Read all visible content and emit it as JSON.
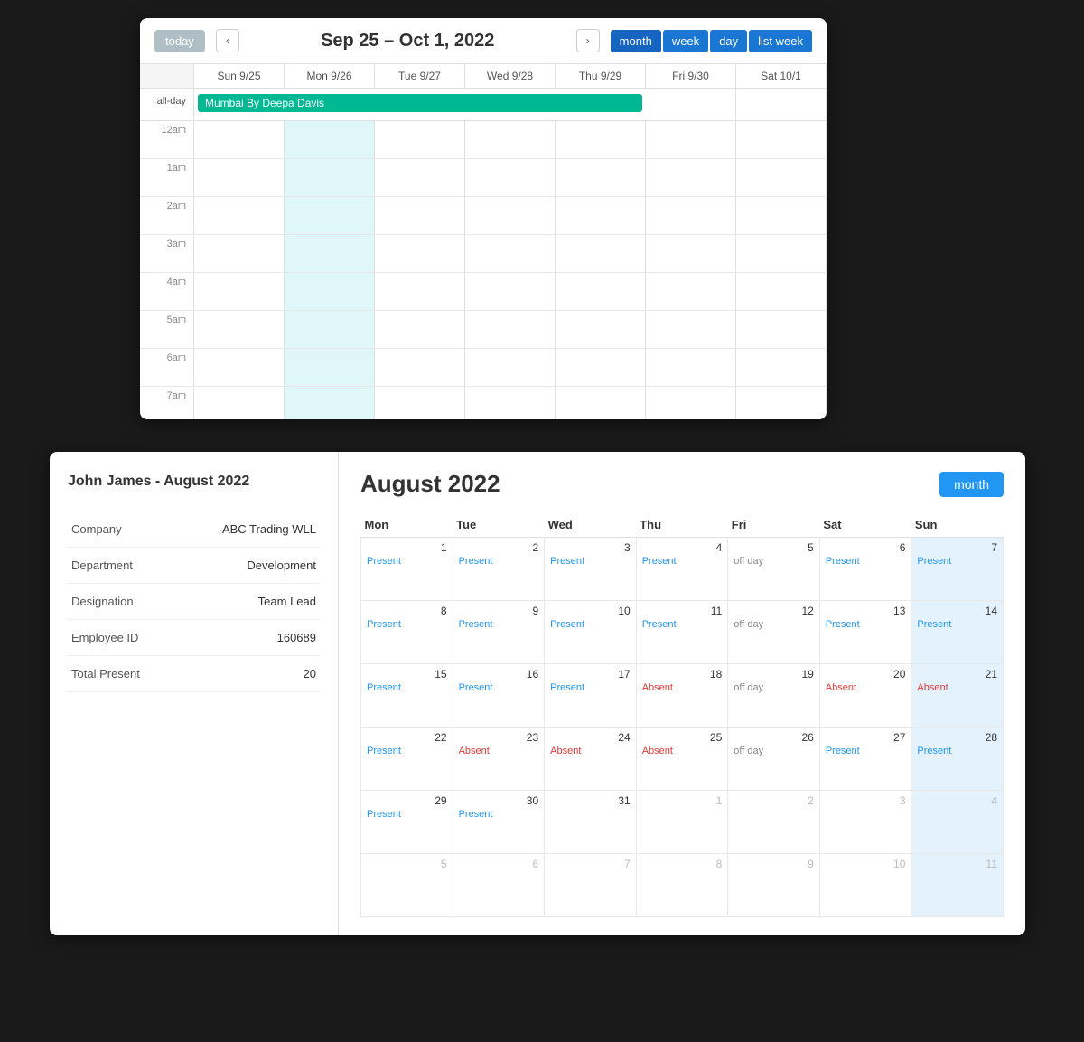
{
  "topCalendar": {
    "todayBtn": "today",
    "prevBtn": "‹",
    "nextBtn": "›",
    "dateRange": "Sep 25 – Oct 1, 2022",
    "viewButtons": [
      {
        "label": "month",
        "active": true
      },
      {
        "label": "week",
        "active": false
      },
      {
        "label": "day",
        "active": false
      },
      {
        "label": "list week",
        "active": false
      }
    ],
    "headerCells": [
      "",
      "Sun 9/25",
      "Mon 9/26",
      "Tue 9/27",
      "Wed 9/28",
      "Thu 9/29",
      "Fri 9/30",
      "Sat 10/1"
    ],
    "allDayLabel": "all-day",
    "event": "Mumbai By Deepa Davis",
    "timeSlots": [
      "12am",
      "1am",
      "2am",
      "3am",
      "4am",
      "5am",
      "6am",
      "7am"
    ]
  },
  "bottomCalendar": {
    "sidebar": {
      "title": "John James - August 2022",
      "fields": [
        {
          "label": "Company",
          "value": "ABC Trading WLL"
        },
        {
          "label": "Department",
          "value": "Development"
        },
        {
          "label": "Designation",
          "value": "Team Lead"
        },
        {
          "label": "Employee ID",
          "value": "160689"
        },
        {
          "label": "Total Present",
          "value": "20"
        }
      ]
    },
    "monthTitle": "August 2022",
    "monthBtn": "month",
    "weekHeaders": [
      "Mon",
      "Tue",
      "Wed",
      "Thu",
      "Fri",
      "Sat",
      "Sun"
    ],
    "weeks": [
      [
        {
          "date": "1",
          "status": "Present",
          "type": "present"
        },
        {
          "date": "2",
          "status": "Present",
          "type": "present"
        },
        {
          "date": "3",
          "status": "Present",
          "type": "present"
        },
        {
          "date": "4",
          "status": "Present",
          "type": "present"
        },
        {
          "date": "5",
          "status": "off day",
          "type": "offday"
        },
        {
          "date": "6",
          "status": "Present",
          "type": "present"
        },
        {
          "date": "7",
          "status": "Present",
          "type": "present",
          "highlight": true
        }
      ],
      [
        {
          "date": "8",
          "status": "Present",
          "type": "present"
        },
        {
          "date": "9",
          "status": "Present",
          "type": "present"
        },
        {
          "date": "10",
          "status": "Present",
          "type": "present"
        },
        {
          "date": "11",
          "status": "Present",
          "type": "present"
        },
        {
          "date": "12",
          "status": "off day",
          "type": "offday"
        },
        {
          "date": "13",
          "status": "Present",
          "type": "present"
        },
        {
          "date": "14",
          "status": "Present",
          "type": "present",
          "highlight": true
        }
      ],
      [
        {
          "date": "15",
          "status": "Present",
          "type": "present"
        },
        {
          "date": "16",
          "status": "Present",
          "type": "present"
        },
        {
          "date": "17",
          "status": "Present",
          "type": "present"
        },
        {
          "date": "18",
          "status": "Absent",
          "type": "absent"
        },
        {
          "date": "19",
          "status": "off day",
          "type": "offday"
        },
        {
          "date": "20",
          "status": "Absent",
          "type": "absent"
        },
        {
          "date": "21",
          "status": "Absent",
          "type": "absent",
          "highlight": true
        }
      ],
      [
        {
          "date": "22",
          "status": "Present",
          "type": "present"
        },
        {
          "date": "23",
          "status": "Absent",
          "type": "absent"
        },
        {
          "date": "24",
          "status": "Absent",
          "type": "absent"
        },
        {
          "date": "25",
          "status": "Absent",
          "type": "absent"
        },
        {
          "date": "26",
          "status": "off day",
          "type": "offday"
        },
        {
          "date": "27",
          "status": "Present",
          "type": "present"
        },
        {
          "date": "28",
          "status": "Present",
          "type": "present",
          "highlight": true
        }
      ],
      [
        {
          "date": "29",
          "status": "Present",
          "type": "present"
        },
        {
          "date": "30",
          "status": "Present",
          "type": "present"
        },
        {
          "date": "31",
          "status": "",
          "type": "empty"
        },
        {
          "date": "1",
          "status": "",
          "type": "other",
          "otherMonth": true
        },
        {
          "date": "2",
          "status": "",
          "type": "other",
          "otherMonth": true
        },
        {
          "date": "3",
          "status": "",
          "type": "other",
          "otherMonth": true
        },
        {
          "date": "4",
          "status": "",
          "type": "other",
          "otherMonth": true,
          "highlight": true
        }
      ],
      [
        {
          "date": "5",
          "status": "",
          "type": "other",
          "otherMonth": true
        },
        {
          "date": "6",
          "status": "",
          "type": "other",
          "otherMonth": true
        },
        {
          "date": "7",
          "status": "",
          "type": "other",
          "otherMonth": true
        },
        {
          "date": "8",
          "status": "",
          "type": "other",
          "otherMonth": true
        },
        {
          "date": "9",
          "status": "",
          "type": "other",
          "otherMonth": true
        },
        {
          "date": "10",
          "status": "",
          "type": "other",
          "otherMonth": true
        },
        {
          "date": "11",
          "status": "",
          "type": "other",
          "otherMonth": true,
          "highlight": true
        }
      ]
    ]
  }
}
